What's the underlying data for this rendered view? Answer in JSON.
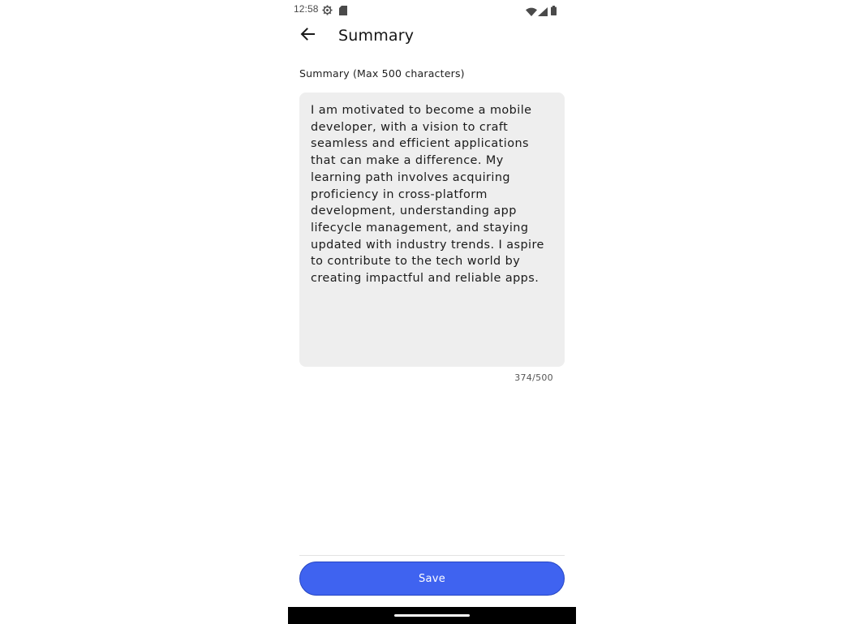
{
  "status_bar": {
    "time": "12:58",
    "icons": [
      "gear-icon",
      "sd-card-icon",
      "wifi-icon",
      "signal-icon",
      "battery-icon"
    ]
  },
  "app_bar": {
    "back_icon": "arrow-left-icon",
    "title": "Summary"
  },
  "form": {
    "label": "Summary (Max 500 characters)",
    "value": "I am motivated to become a mobile developer, with a vision to craft seamless and efficient applications that can make a difference. My learning path involves acquiring proficiency in cross-platform development, understanding app lifecycle management, and staying updated with industry trends. I aspire to contribute to the tech world by creating impactful and reliable apps.",
    "counter": "374/500"
  },
  "actions": {
    "save_label": "Save"
  },
  "colors": {
    "accent": "#3f63f0",
    "field_background": "#eeeeee"
  }
}
